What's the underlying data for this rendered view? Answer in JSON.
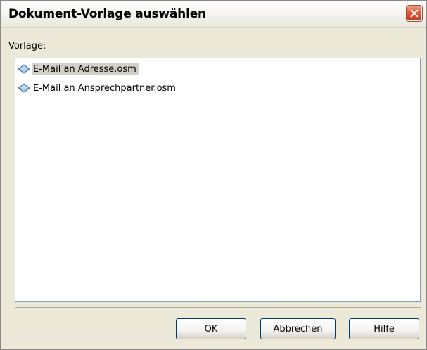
{
  "window": {
    "title": "Dokument-Vorlage auswählen",
    "close_icon": "close-icon"
  },
  "template_list": {
    "label": "Vorlage:",
    "items": [
      {
        "label": "E-Mail an Adresse.osm",
        "icon": "email-template-icon",
        "selected": true
      },
      {
        "label": "E-Mail an Ansprechpartner.osm",
        "icon": "email-template-icon",
        "selected": false
      }
    ]
  },
  "buttons": {
    "ok_label": "OK",
    "cancel_label": "Abbrechen",
    "help_label": "Hilfe"
  },
  "colors": {
    "dialog_background": "#ece9d8",
    "selection_background": "#d4d0c8",
    "close_button": "#e2553b"
  }
}
